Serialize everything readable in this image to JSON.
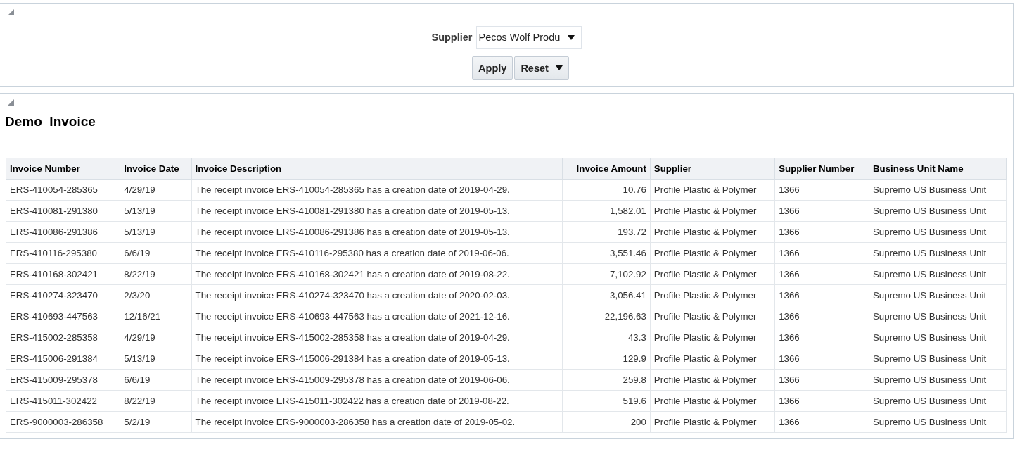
{
  "filter_panel": {
    "expanded": true,
    "supplier_label": "Supplier",
    "supplier_value": "Pecos Wolf Produ",
    "buttons": [
      {
        "label": "Apply",
        "kind": "plain"
      },
      {
        "label": "Reset",
        "kind": "menu"
      }
    ]
  },
  "report_panel": {
    "expanded": true,
    "title": "Demo_Invoice",
    "table": {
      "columns": [
        {
          "label": "Invoice Number",
          "kind": "text"
        },
        {
          "label": "Invoice Date",
          "kind": "text"
        },
        {
          "label": "Invoice Description",
          "kind": "text"
        },
        {
          "label": "Invoice Amount",
          "kind": "number"
        },
        {
          "label": "Supplier",
          "kind": "text"
        },
        {
          "label": "Supplier Number",
          "kind": "text"
        },
        {
          "label": "Business Unit Name",
          "kind": "text"
        }
      ],
      "rows": [
        [
          "ERS-410054-285365",
          "4/29/19",
          "The receipt invoice ERS-410054-285365 has a creation date of 2019-04-29.",
          "10.76",
          "Profile Plastic & Polymer",
          "1366",
          "Supremo US Business Unit"
        ],
        [
          "ERS-410081-291380",
          "5/13/19",
          "The receipt invoice ERS-410081-291380 has a creation date of 2019-05-13.",
          "1,582.01",
          "Profile Plastic & Polymer",
          "1366",
          "Supremo US Business Unit"
        ],
        [
          "ERS-410086-291386",
          "5/13/19",
          "The receipt invoice ERS-410086-291386 has a creation date of 2019-05-13.",
          "193.72",
          "Profile Plastic & Polymer",
          "1366",
          "Supremo US Business Unit"
        ],
        [
          "ERS-410116-295380",
          "6/6/19",
          "The receipt invoice ERS-410116-295380 has a creation date of 2019-06-06.",
          "3,551.46",
          "Profile Plastic & Polymer",
          "1366",
          "Supremo US Business Unit"
        ],
        [
          "ERS-410168-302421",
          "8/22/19",
          "The receipt invoice ERS-410168-302421 has a creation date of 2019-08-22.",
          "7,102.92",
          "Profile Plastic & Polymer",
          "1366",
          "Supremo US Business Unit"
        ],
        [
          "ERS-410274-323470",
          "2/3/20",
          "The receipt invoice ERS-410274-323470 has a creation date of 2020-02-03.",
          "3,056.41",
          "Profile Plastic & Polymer",
          "1366",
          "Supremo US Business Unit"
        ],
        [
          "ERS-410693-447563",
          "12/16/21",
          "The receipt invoice ERS-410693-447563 has a creation date of 2021-12-16.",
          "22,196.63",
          "Profile Plastic & Polymer",
          "1366",
          "Supremo US Business Unit"
        ],
        [
          "ERS-415002-285358",
          "4/29/19",
          "The receipt invoice ERS-415002-285358 has a creation date of 2019-04-29.",
          "43.3",
          "Profile Plastic & Polymer",
          "1366",
          "Supremo US Business Unit"
        ],
        [
          "ERS-415006-291384",
          "5/13/19",
          "The receipt invoice ERS-415006-291384 has a creation date of 2019-05-13.",
          "129.9",
          "Profile Plastic & Polymer",
          "1366",
          "Supremo US Business Unit"
        ],
        [
          "ERS-415009-295378",
          "6/6/19",
          "The receipt invoice ERS-415009-295378 has a creation date of 2019-06-06.",
          "259.8",
          "Profile Plastic & Polymer",
          "1366",
          "Supremo US Business Unit"
        ],
        [
          "ERS-415011-302422",
          "8/22/19",
          "The receipt invoice ERS-415011-302422 has a creation date of 2019-08-22.",
          "519.6",
          "Profile Plastic & Polymer",
          "1366",
          "Supremo US Business Unit"
        ],
        [
          "ERS-9000003-286358",
          "5/2/19",
          "The receipt invoice ERS-9000003-286358 has a creation date of 2019-05-02.",
          "200",
          "Profile Plastic & Polymer",
          "1366",
          "Supremo US Business Unit"
        ]
      ]
    }
  }
}
